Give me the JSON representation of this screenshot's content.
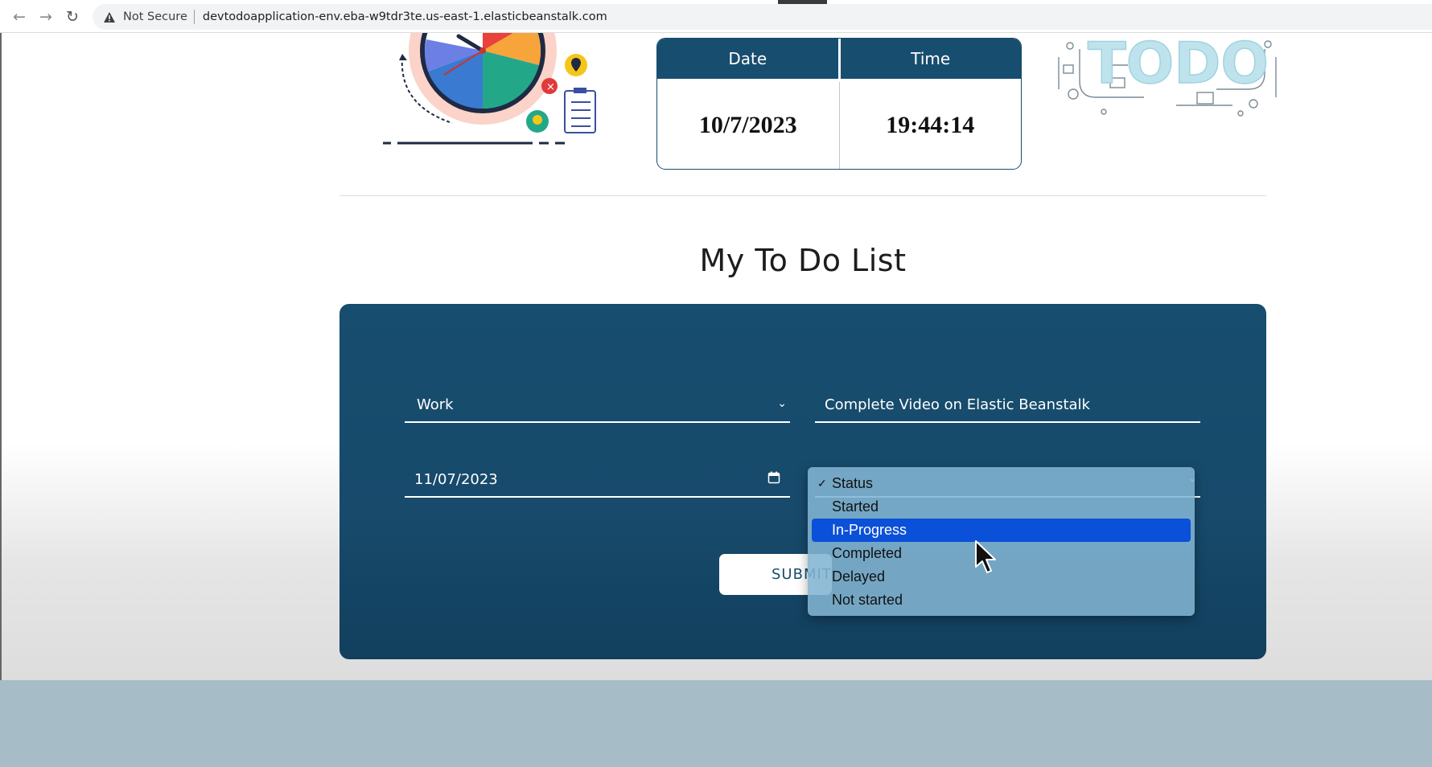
{
  "browser": {
    "security_label": "Not Secure",
    "url": "devtodoapplication-env.eba-w9tdr3te.us-east-1.elasticbeanstalk.com",
    "icons": [
      "back-arrow-icon",
      "forward-arrow-icon",
      "reload-icon",
      "warning-icon"
    ]
  },
  "datetime": {
    "date_header": "Date",
    "time_header": "Time",
    "date_value": "10/7/2023",
    "time_value": "19:44:14"
  },
  "todo": {
    "title": "My To Do List",
    "form": {
      "category_value": "Work",
      "task_value": "Complete Video on Elastic Beanstalk",
      "date_value": "11/07/2023",
      "submit_label": "SUBMIT"
    },
    "status_dropdown": {
      "checked": "Status",
      "highlighted": "In-Progress",
      "options": [
        "Status",
        "Started",
        "In-Progress",
        "Completed",
        "Delayed",
        "Not started"
      ]
    }
  },
  "colors": {
    "primary": "#174d6f",
    "highlight": "#0b50d8",
    "footer": "#a6bcc6"
  }
}
